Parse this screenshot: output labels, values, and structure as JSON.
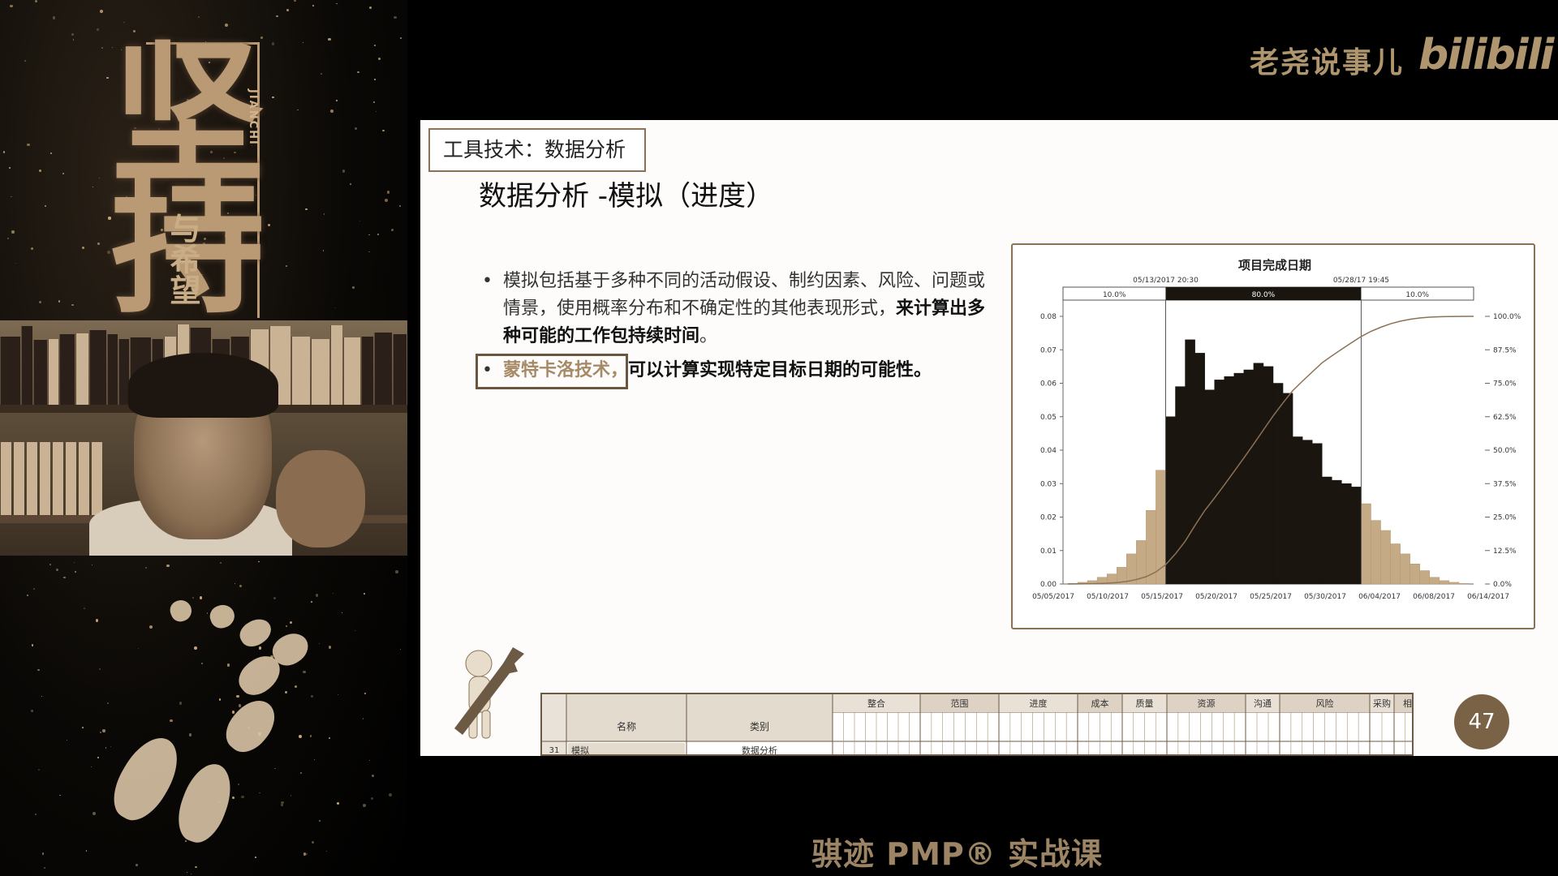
{
  "brand": {
    "channel_name": "老尧说事儿",
    "logo_text": "bilibili"
  },
  "poster": {
    "title": "坚持",
    "subtitle": "与希望",
    "english": "JIANCHI"
  },
  "slide": {
    "section_tag": "工具技术：数据分析",
    "title": "数据分析 -模拟（进度）",
    "bullet1_part1": "模拟包括基于多种不同的活动假设、制约因素、风险、问题或情景，使用概率分布和不确定性的其他表现形式，",
    "bullet1_part2": "来计算出多种可能的工作包持续时间",
    "bullet1_end": "。",
    "bullet2_term": "蒙特卡洛技术，",
    "bullet2_rest": "可以计算实现特定目标日期的可能性。",
    "page_number": "47"
  },
  "chart_data": {
    "type": "bar",
    "title": "项目完成日期",
    "marker_left": "05/13/2017  20:30",
    "marker_right": "05/28/17  19:45",
    "band_labels": [
      "10.0%",
      "80.0%",
      "10.0%"
    ],
    "x_tick_labels": [
      "05/05/2017",
      "05/10/2017",
      "05/15/2017",
      "05/20/2017",
      "05/25/2017",
      "05/30/2017",
      "06/04/2017",
      "06/08/2017",
      "06/14/2017"
    ],
    "y_left_ticks": [
      "0.00",
      "0.01",
      "0.02",
      "0.03",
      "0.04",
      "0.05",
      "0.06",
      "0.07",
      "0.08"
    ],
    "y_right_ticks": [
      "0.0%",
      "12.5%",
      "25.0%",
      "37.5%",
      "50.0%",
      "62.5%",
      "75.0%",
      "87.5%",
      "100.0%"
    ],
    "ylim": [
      0,
      0.08
    ],
    "values": [
      0.0002,
      0.0005,
      0.001,
      0.002,
      0.003,
      0.005,
      0.009,
      0.013,
      0.022,
      0.034,
      0.05,
      0.059,
      0.073,
      0.069,
      0.058,
      0.061,
      0.062,
      0.063,
      0.064,
      0.066,
      0.065,
      0.06,
      0.057,
      0.044,
      0.043,
      0.042,
      0.032,
      0.031,
      0.03,
      0.029,
      0.024,
      0.019,
      0.016,
      0.012,
      0.009,
      0.006,
      0.004,
      0.002,
      0.001,
      0.0005,
      0.0002
    ],
    "highlight_range": [
      10,
      29
    ]
  },
  "table": {
    "group_headers": [
      "整合",
      "范围",
      "进度",
      "成本",
      "质量",
      "资源",
      "沟通",
      "风险",
      "采购",
      "相关方"
    ],
    "col_name": "名称",
    "col_type": "类别",
    "row": {
      "index": "31",
      "name": "模拟",
      "type": "数据分析"
    }
  },
  "course_title": "骐迹 PMP® 实战课"
}
